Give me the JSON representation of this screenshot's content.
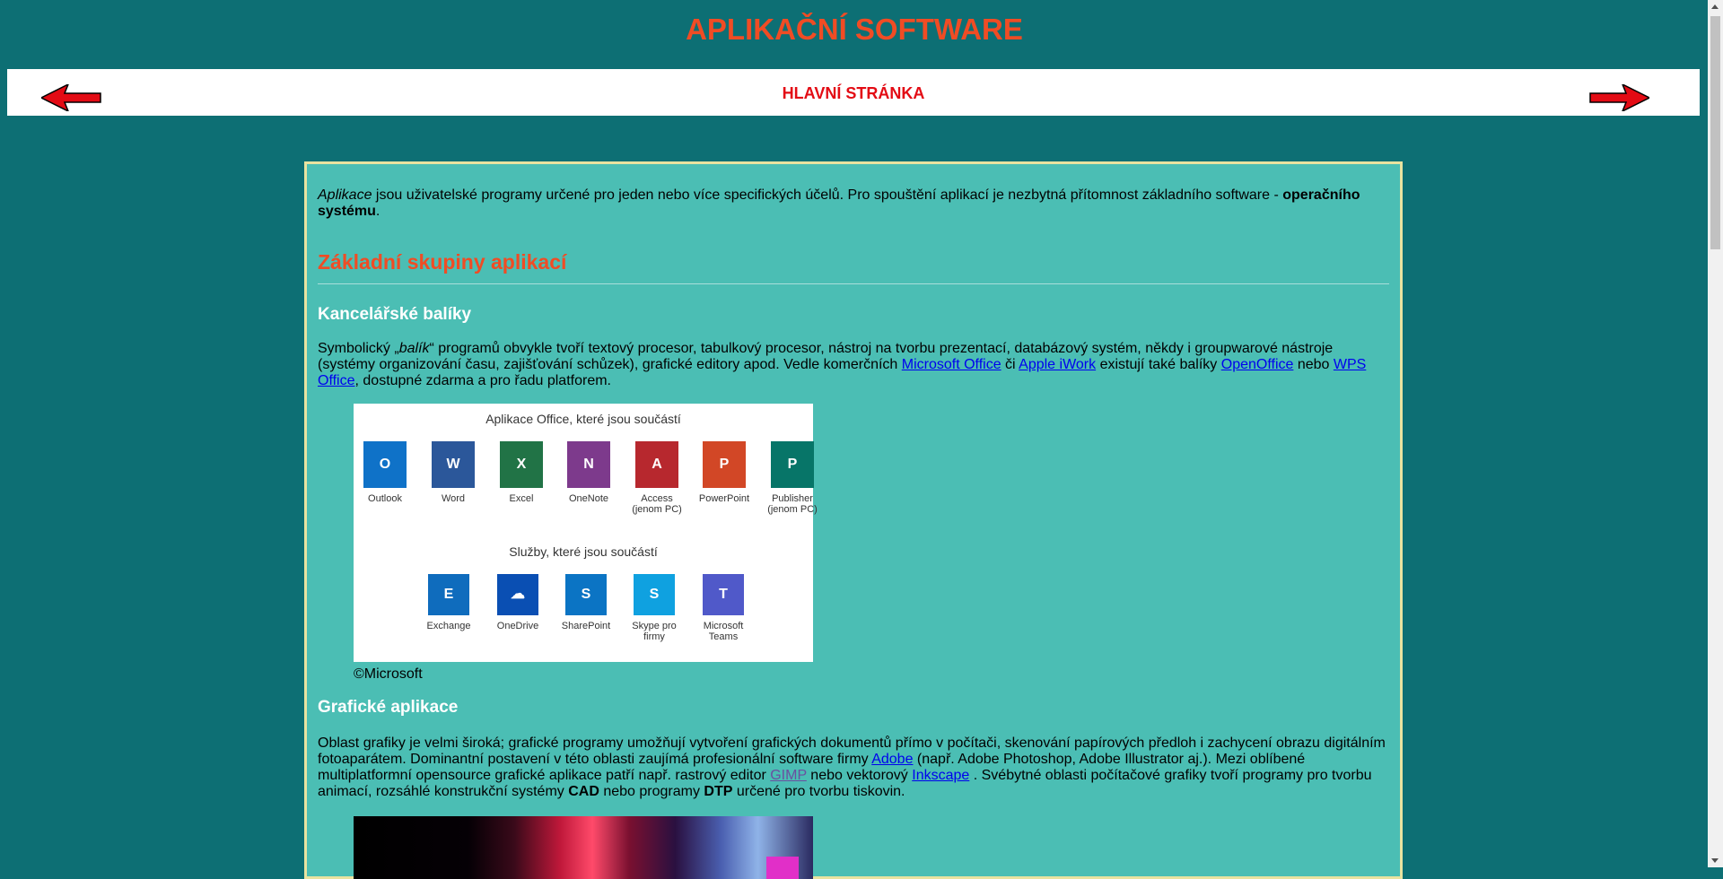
{
  "header": {
    "title": "APLIKAČNÍ SOFTWARE"
  },
  "nav": {
    "home_label": "HLAVNÍ STRÁNKA",
    "prev_icon": "left-arrow-icon",
    "next_icon": "right-arrow-icon",
    "arrow_color": "#e30b14"
  },
  "intro": {
    "em": "Aplikace",
    "text": " jsou uživatelské programy určené pro jeden nebo více specifických účelů. Pro spouštění aplikací je nezbytná přítomnost základního software - ",
    "bold": "operačního systému",
    "end": "."
  },
  "section": {
    "title": "Základní skupiny aplikací"
  },
  "office": {
    "heading": "Kancelářské balíky",
    "t1": "Symbolický „",
    "em": "balík",
    "t2": "“ programů obvykle tvoří textový procesor, tabulkový procesor, nástroj na tvorbu prezentací, databázový systém, někdy i groupwarové nástroje (systémy organizování času, zajišťování schůzek), grafické editory apod. Vedle komerčních ",
    "link_ms": "Microsoft Office",
    "t3": " či ",
    "link_iwork": "Apple iWork",
    "t4": " existují také balíky ",
    "link_oo": "OpenOffice",
    "t5": " nebo ",
    "link_wps": "WPS Office",
    "t6": ", dostupné zdarma a pro řadu platforem.",
    "image": {
      "caption_apps": "Aplikace Office, které jsou součástí",
      "caption_services": "Služby, které jsou součástí",
      "apps": [
        {
          "label": "Outlook",
          "letter": "O",
          "color": "#0f72c8"
        },
        {
          "label": "Word",
          "letter": "W",
          "color": "#2b579a"
        },
        {
          "label": "Excel",
          "letter": "X",
          "color": "#217346"
        },
        {
          "label": "OneNote",
          "letter": "N",
          "color": "#7d3a8c"
        },
        {
          "label": "Access (jenom PC)",
          "letter": "A",
          "color": "#b7282e"
        },
        {
          "label": "PowerPoint",
          "letter": "P",
          "color": "#d24726"
        },
        {
          "label": "Publisher (jenom PC)",
          "letter": "P",
          "color": "#077568"
        }
      ],
      "services": [
        {
          "label": "Exchange",
          "letter": "E",
          "color": "#0f6cbd"
        },
        {
          "label": "OneDrive",
          "letter": "☁",
          "color": "#0a4fb3"
        },
        {
          "label": "SharePoint",
          "letter": "S",
          "color": "#0b74c4"
        },
        {
          "label": "Skype pro firmy",
          "letter": "S",
          "color": "#0fa1e0"
        },
        {
          "label": "Microsoft Teams",
          "letter": "T",
          "color": "#5059c9"
        }
      ]
    },
    "copyright": "©Microsoft"
  },
  "graphics": {
    "heading": "Grafické aplikace",
    "t1": "Oblast grafiky je velmi široká; grafické programy umožňují vytvoření grafických dokumentů přímo v počítači, skenování papírových předloh i zachycení obrazu digitálním fotoaparátem. Dominantní postavení v této oblasti zaujímá profesionální software firmy ",
    "link_adobe": "Adobe",
    "t2": " (např. Adobe Photoshop, Adobe Illustrator aj.). Mezi oblíbené multiplatformní opensource grafické aplikace patří např. rastrový editor ",
    "link_gimp": "GIMP",
    "t3": " nebo vektorový ",
    "link_inkscape": "Inkscape",
    "t4": " . Svébytné oblasti počítačové grafiky tvoří programy pro tvorbu animací, rozsáhlé konstrukční systémy ",
    "bold_cad": "CAD",
    "t5": " nebo programy ",
    "bold_dtp": "DTP",
    "t6": " určené pro tvorbu tiskovin."
  }
}
